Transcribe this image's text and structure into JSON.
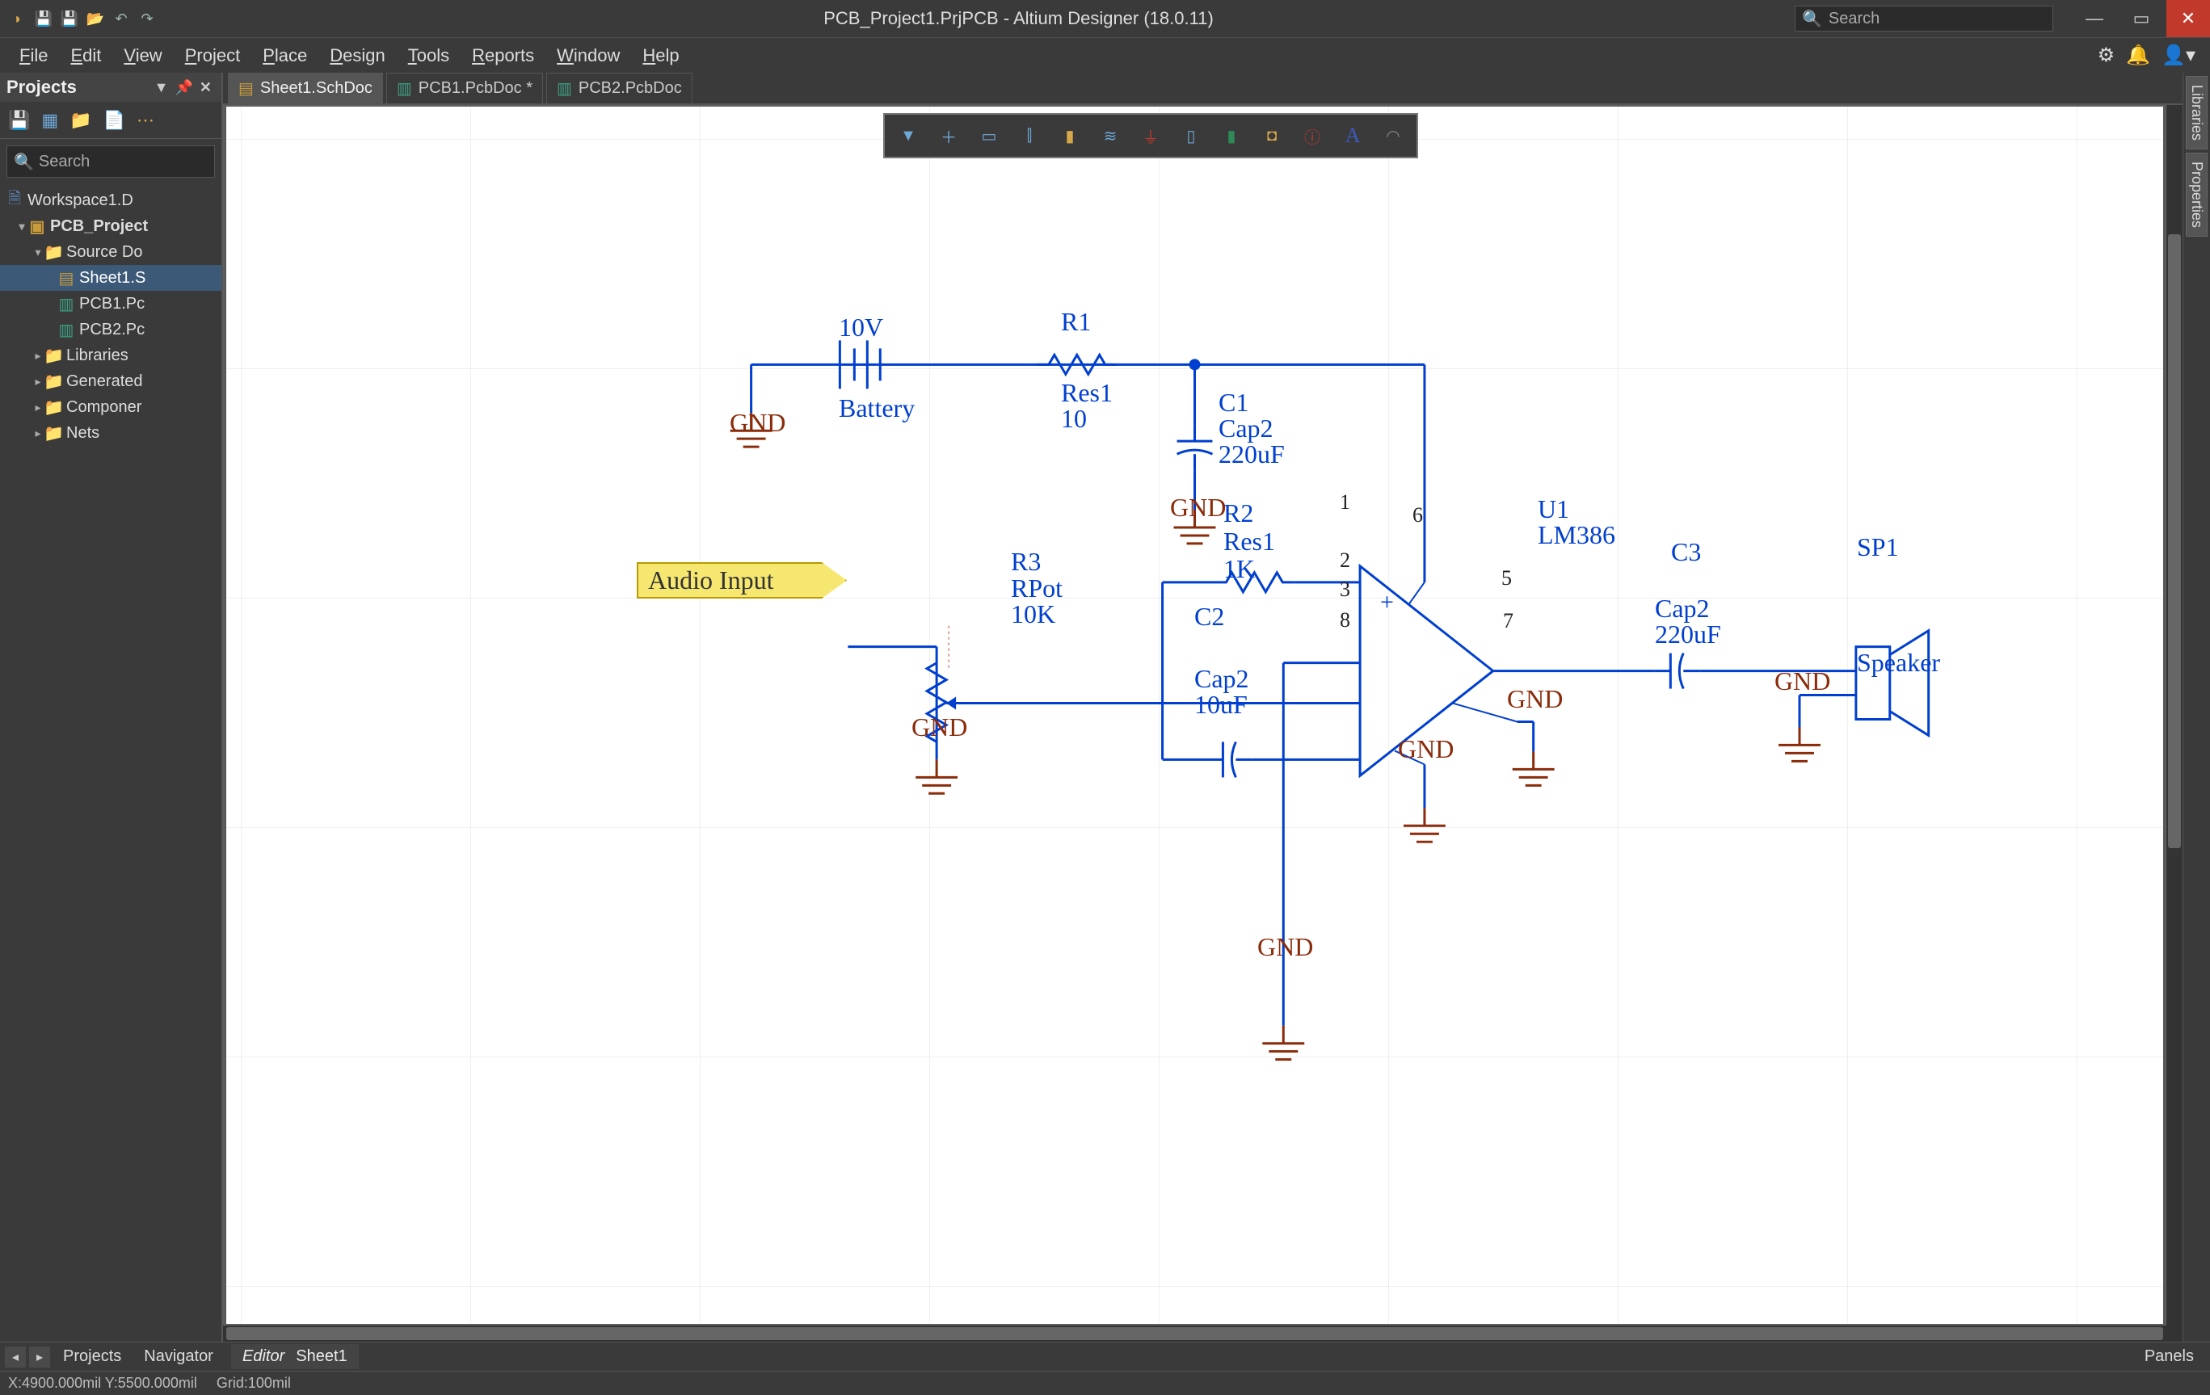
{
  "window": {
    "title": "PCB_Project1.PrjPCB - Altium Designer (18.0.11)",
    "search_placeholder": "Search"
  },
  "menu": {
    "items": [
      "File",
      "Edit",
      "View",
      "Project",
      "Place",
      "Design",
      "Tools",
      "Reports",
      "Window",
      "Help"
    ]
  },
  "projects_panel": {
    "title": "Projects",
    "search_placeholder": "Search",
    "tree": {
      "workspace": "Workspace1.D",
      "project": "PCB_Project",
      "source": "Source Do",
      "files": [
        "Sheet1.S",
        "PCB1.Pc",
        "PCB2.Pc"
      ],
      "folders": [
        "Libraries",
        "Generated",
        "Componer",
        "Nets"
      ]
    }
  },
  "tabs": {
    "items": [
      {
        "label": "Sheet1.SchDoc",
        "type": "schdoc",
        "dirty": false,
        "active": true
      },
      {
        "label": "PCB1.PcbDoc",
        "type": "pcbdoc",
        "dirty": true,
        "active": false
      },
      {
        "label": "PCB2.PcbDoc",
        "type": "pcbdoc",
        "dirty": false,
        "active": false
      }
    ]
  },
  "right_dock": {
    "tabs": [
      "Libraries",
      "Properties"
    ]
  },
  "bottom": {
    "projects_tab": "Projects",
    "navigator_tab": "Navigator",
    "editor_label": "Editor",
    "sheet_label": "Sheet1",
    "panels_label": "Panels"
  },
  "status": {
    "coords": "X:4900.000mil Y:5500.000mil",
    "grid": "Grid:100mil"
  },
  "place_toolbar_icons": [
    "filter",
    "cross",
    "select",
    "align",
    "bus",
    "net",
    "power",
    "harness",
    "sheet",
    "directive",
    "info",
    "text",
    "arc"
  ],
  "schematic": {
    "port": "Audio Input",
    "battery": {
      "voltage": "10V",
      "name": "Battery"
    },
    "gnd": "GND",
    "R1": {
      "ref": "R1",
      "type": "Res1",
      "val": "10"
    },
    "R2": {
      "ref": "R2",
      "type": "Res1",
      "val": "1K"
    },
    "R3": {
      "ref": "R3",
      "type": "RPot",
      "val": "10K"
    },
    "C1": {
      "ref": "C1",
      "type": "Cap2",
      "val": "220uF"
    },
    "C2": {
      "ref": "C2",
      "type": "Cap2",
      "val": "10uF"
    },
    "C3": {
      "ref": "C3",
      "type": "Cap2",
      "val": "220uF"
    },
    "U1": {
      "ref": "U1",
      "type": "LM386",
      "pins": {
        "p1": "1",
        "p2": "2",
        "p3": "3",
        "p5": "5",
        "p6": "6",
        "p7": "7",
        "p8": "8"
      }
    },
    "SP1": {
      "ref": "SP1",
      "type": "Speaker"
    },
    "opamp_plus": "+"
  }
}
